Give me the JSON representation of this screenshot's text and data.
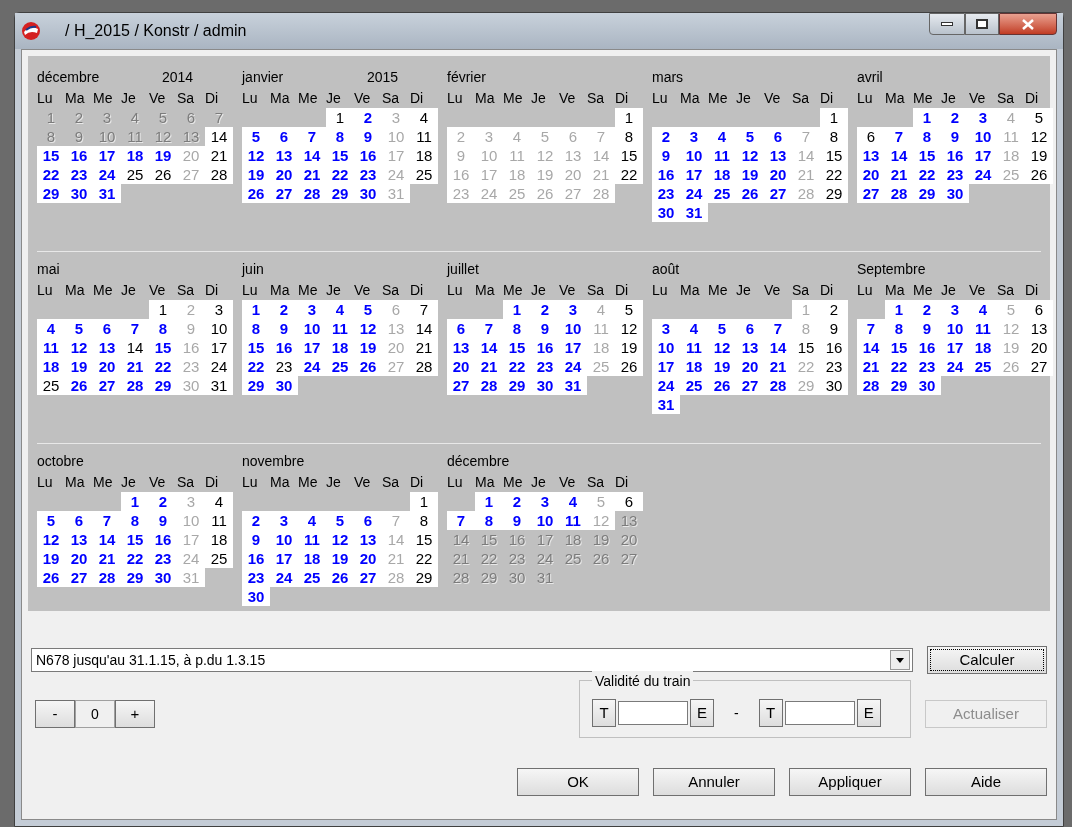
{
  "window": {
    "title": "/ H_2015 / Konstr / admin"
  },
  "months": [
    {
      "name": "décembre",
      "year": "2014",
      "kind": "monday",
      "weekdays": [
        "Lu",
        "Ma",
        "Me",
        "Je",
        "Ve",
        "Sa",
        "Di"
      ],
      "days": [
        {
          "text": "1",
          "kind": "outside"
        },
        {
          "text": "2",
          "kind": "outside"
        },
        {
          "text": "3",
          "kind": "outside"
        },
        {
          "text": "4",
          "kind": "outside"
        },
        {
          "text": "5",
          "kind": "outside"
        },
        {
          "text": "6",
          "kind": "outside"
        },
        {
          "text": "7",
          "kind": "outside"
        },
        {
          "text": "8",
          "kind": "outside"
        },
        {
          "text": "9",
          "kind": "outside"
        },
        {
          "text": "10",
          "kind": "outside"
        },
        {
          "text": "11",
          "kind": "outside"
        },
        {
          "text": "12",
          "kind": "outside"
        },
        {
          "text": "13",
          "kind": "outside"
        },
        {
          "text": "14",
          "kind": "plain"
        },
        {
          "text": "15",
          "kind": "active"
        },
        {
          "text": "16",
          "kind": "active"
        },
        {
          "text": "17",
          "kind": "active"
        },
        {
          "text": "18",
          "kind": "active"
        },
        {
          "text": "19",
          "kind": "active"
        },
        {
          "text": "20",
          "kind": "grey"
        },
        {
          "text": "21",
          "kind": "plain"
        },
        {
          "text": "22",
          "kind": "active"
        },
        {
          "text": "23",
          "kind": "active"
        },
        {
          "text": "24",
          "kind": "active"
        },
        {
          "text": "25",
          "kind": "plain"
        },
        {
          "text": "26",
          "kind": "plain"
        },
        {
          "text": "27",
          "kind": "grey"
        },
        {
          "text": "28",
          "kind": "plain"
        },
        {
          "text": "29",
          "kind": "active"
        },
        {
          "text": "30",
          "kind": "active"
        },
        {
          "text": "31",
          "kind": "active"
        }
      ]
    },
    {
      "name": "janvier",
      "year": "2015",
      "kind": "thursday",
      "weekdays": [
        "Lu",
        "Ma",
        "Me",
        "Je",
        "Ve",
        "Sa",
        "Di"
      ],
      "days": [
        {
          "text": "1",
          "kind": "plain"
        },
        {
          "text": "2",
          "kind": "active"
        },
        {
          "text": "3",
          "kind": "grey"
        },
        {
          "text": "4",
          "kind": "plain"
        },
        {
          "text": "5",
          "kind": "active"
        },
        {
          "text": "6",
          "kind": "active"
        },
        {
          "text": "7",
          "kind": "active"
        },
        {
          "text": "8",
          "kind": "active"
        },
        {
          "text": "9",
          "kind": "active"
        },
        {
          "text": "10",
          "kind": "grey"
        },
        {
          "text": "11",
          "kind": "plain"
        },
        {
          "text": "12",
          "kind": "active"
        },
        {
          "text": "13",
          "kind": "active"
        },
        {
          "text": "14",
          "kind": "active"
        },
        {
          "text": "15",
          "kind": "active"
        },
        {
          "text": "16",
          "kind": "active"
        },
        {
          "text": "17",
          "kind": "grey"
        },
        {
          "text": "18",
          "kind": "plain"
        },
        {
          "text": "19",
          "kind": "active"
        },
        {
          "text": "20",
          "kind": "active"
        },
        {
          "text": "21",
          "kind": "active"
        },
        {
          "text": "22",
          "kind": "active"
        },
        {
          "text": "23",
          "kind": "active"
        },
        {
          "text": "24",
          "kind": "grey"
        },
        {
          "text": "25",
          "kind": "plain"
        },
        {
          "text": "26",
          "kind": "active"
        },
        {
          "text": "27",
          "kind": "active"
        },
        {
          "text": "28",
          "kind": "active"
        },
        {
          "text": "29",
          "kind": "active"
        },
        {
          "text": "30",
          "kind": "active"
        },
        {
          "text": "31",
          "kind": "grey"
        }
      ]
    },
    {
      "name": "février",
      "kind": "sunday",
      "weekdays": [
        "Lu",
        "Ma",
        "Me",
        "Je",
        "Ve",
        "Sa",
        "Di"
      ],
      "days": [
        {
          "text": "1",
          "kind": "plain"
        },
        {
          "text": "2",
          "kind": "grey"
        },
        {
          "text": "3",
          "kind": "grey"
        },
        {
          "text": "4",
          "kind": "grey"
        },
        {
          "text": "5",
          "kind": "grey"
        },
        {
          "text": "6",
          "kind": "grey"
        },
        {
          "text": "7",
          "kind": "grey"
        },
        {
          "text": "8",
          "kind": "plain"
        },
        {
          "text": "9",
          "kind": "grey"
        },
        {
          "text": "10",
          "kind": "grey"
        },
        {
          "text": "11",
          "kind": "grey"
        },
        {
          "text": "12",
          "kind": "grey"
        },
        {
          "text": "13",
          "kind": "grey"
        },
        {
          "text": "14",
          "kind": "grey"
        },
        {
          "text": "15",
          "kind": "plain"
        },
        {
          "text": "16",
          "kind": "grey"
        },
        {
          "text": "17",
          "kind": "grey"
        },
        {
          "text": "18",
          "kind": "grey"
        },
        {
          "text": "19",
          "kind": "grey"
        },
        {
          "text": "20",
          "kind": "grey"
        },
        {
          "text": "21",
          "kind": "grey"
        },
        {
          "text": "22",
          "kind": "plain"
        },
        {
          "text": "23",
          "kind": "grey"
        },
        {
          "text": "24",
          "kind": "grey"
        },
        {
          "text": "25",
          "kind": "grey"
        },
        {
          "text": "26",
          "kind": "grey"
        },
        {
          "text": "27",
          "kind": "grey"
        },
        {
          "text": "28",
          "kind": "grey"
        }
      ]
    },
    {
      "name": "mars",
      "kind": "sunday",
      "weekdays": [
        "Lu",
        "Ma",
        "Me",
        "Je",
        "Ve",
        "Sa",
        "Di"
      ],
      "days": [
        {
          "text": "1",
          "kind": "plain"
        },
        {
          "text": "2",
          "kind": "active"
        },
        {
          "text": "3",
          "kind": "active"
        },
        {
          "text": "4",
          "kind": "active"
        },
        {
          "text": "5",
          "kind": "active"
        },
        {
          "text": "6",
          "kind": "active"
        },
        {
          "text": "7",
          "kind": "grey"
        },
        {
          "text": "8",
          "kind": "plain"
        },
        {
          "text": "9",
          "kind": "active"
        },
        {
          "text": "10",
          "kind": "active"
        },
        {
          "text": "11",
          "kind": "active"
        },
        {
          "text": "12",
          "kind": "active"
        },
        {
          "text": "13",
          "kind": "active"
        },
        {
          "text": "14",
          "kind": "grey"
        },
        {
          "text": "15",
          "kind": "plain"
        },
        {
          "text": "16",
          "kind": "active"
        },
        {
          "text": "17",
          "kind": "active"
        },
        {
          "text": "18",
          "kind": "active"
        },
        {
          "text": "19",
          "kind": "active"
        },
        {
          "text": "20",
          "kind": "active"
        },
        {
          "text": "21",
          "kind": "grey"
        },
        {
          "text": "22",
          "kind": "plain"
        },
        {
          "text": "23",
          "kind": "active"
        },
        {
          "text": "24",
          "kind": "active"
        },
        {
          "text": "25",
          "kind": "active"
        },
        {
          "text": "26",
          "kind": "active"
        },
        {
          "text": "27",
          "kind": "active"
        },
        {
          "text": "28",
          "kind": "grey"
        },
        {
          "text": "29",
          "kind": "plain"
        },
        {
          "text": "30",
          "kind": "active"
        },
        {
          "text": "31",
          "kind": "active"
        }
      ]
    },
    {
      "name": "avril",
      "kind": "wednesday",
      "weekdays": [
        "Lu",
        "Ma",
        "Me",
        "Je",
        "Ve",
        "Sa",
        "Di"
      ],
      "days": [
        {
          "text": "1",
          "kind": "active"
        },
        {
          "text": "2",
          "kind": "active"
        },
        {
          "text": "3",
          "kind": "active"
        },
        {
          "text": "4",
          "kind": "grey"
        },
        {
          "text": "5",
          "kind": "plain"
        },
        {
          "text": "6",
          "kind": "plain"
        },
        {
          "text": "7",
          "kind": "active"
        },
        {
          "text": "8",
          "kind": "active"
        },
        {
          "text": "9",
          "kind": "active"
        },
        {
          "text": "10",
          "kind": "active"
        },
        {
          "text": "11",
          "kind": "grey"
        },
        {
          "text": "12",
          "kind": "plain"
        },
        {
          "text": "13",
          "kind": "active"
        },
        {
          "text": "14",
          "kind": "active"
        },
        {
          "text": "15",
          "kind": "active"
        },
        {
          "text": "16",
          "kind": "active"
        },
        {
          "text": "17",
          "kind": "active"
        },
        {
          "text": "18",
          "kind": "grey"
        },
        {
          "text": "19",
          "kind": "plain"
        },
        {
          "text": "20",
          "kind": "active"
        },
        {
          "text": "21",
          "kind": "active"
        },
        {
          "text": "22",
          "kind": "active"
        },
        {
          "text": "23",
          "kind": "active"
        },
        {
          "text": "24",
          "kind": "active"
        },
        {
          "text": "25",
          "kind": "grey"
        },
        {
          "text": "26",
          "kind": "plain"
        },
        {
          "text": "27",
          "kind": "active"
        },
        {
          "text": "28",
          "kind": "active"
        },
        {
          "text": "29",
          "kind": "active"
        },
        {
          "text": "30",
          "kind": "active"
        }
      ]
    },
    {
      "name": "mai",
      "kind": "friday",
      "weekdays": [
        "Lu",
        "Ma",
        "Me",
        "Je",
        "Ve",
        "Sa",
        "Di"
      ],
      "days": [
        {
          "text": "1",
          "kind": "plain"
        },
        {
          "text": "2",
          "kind": "grey"
        },
        {
          "text": "3",
          "kind": "plain"
        },
        {
          "text": "4",
          "kind": "active"
        },
        {
          "text": "5",
          "kind": "active"
        },
        {
          "text": "6",
          "kind": "active"
        },
        {
          "text": "7",
          "kind": "active"
        },
        {
          "text": "8",
          "kind": "active"
        },
        {
          "text": "9",
          "kind": "grey"
        },
        {
          "text": "10",
          "kind": "plain"
        },
        {
          "text": "11",
          "kind": "active"
        },
        {
          "text": "12",
          "kind": "active"
        },
        {
          "text": "13",
          "kind": "active"
        },
        {
          "text": "14",
          "kind": "plain"
        },
        {
          "text": "15",
          "kind": "active"
        },
        {
          "text": "16",
          "kind": "grey"
        },
        {
          "text": "17",
          "kind": "plain"
        },
        {
          "text": "18",
          "kind": "active"
        },
        {
          "text": "19",
          "kind": "active"
        },
        {
          "text": "20",
          "kind": "active"
        },
        {
          "text": "21",
          "kind": "active"
        },
        {
          "text": "22",
          "kind": "active"
        },
        {
          "text": "23",
          "kind": "grey"
        },
        {
          "text": "24",
          "kind": "plain"
        },
        {
          "text": "25",
          "kind": "plain"
        },
        {
          "text": "26",
          "kind": "active"
        },
        {
          "text": "27",
          "kind": "active"
        },
        {
          "text": "28",
          "kind": "active"
        },
        {
          "text": "29",
          "kind": "active"
        },
        {
          "text": "30",
          "kind": "grey"
        },
        {
          "text": "31",
          "kind": "plain"
        }
      ]
    },
    {
      "name": "juin",
      "kind": "monday",
      "weekdays": [
        "Lu",
        "Ma",
        "Me",
        "Je",
        "Ve",
        "Sa",
        "Di"
      ],
      "days": [
        {
          "text": "1",
          "kind": "active"
        },
        {
          "text": "2",
          "kind": "active"
        },
        {
          "text": "3",
          "kind": "active"
        },
        {
          "text": "4",
          "kind": "active"
        },
        {
          "text": "5",
          "kind": "active"
        },
        {
          "text": "6",
          "kind": "grey"
        },
        {
          "text": "7",
          "kind": "plain"
        },
        {
          "text": "8",
          "kind": "active"
        },
        {
          "text": "9",
          "kind": "active"
        },
        {
          "text": "10",
          "kind": "active"
        },
        {
          "text": "11",
          "kind": "active"
        },
        {
          "text": "12",
          "kind": "active"
        },
        {
          "text": "13",
          "kind": "grey"
        },
        {
          "text": "14",
          "kind": "plain"
        },
        {
          "text": "15",
          "kind": "active"
        },
        {
          "text": "16",
          "kind": "active"
        },
        {
          "text": "17",
          "kind": "active"
        },
        {
          "text": "18",
          "kind": "active"
        },
        {
          "text": "19",
          "kind": "active"
        },
        {
          "text": "20",
          "kind": "grey"
        },
        {
          "text": "21",
          "kind": "plain"
        },
        {
          "text": "22",
          "kind": "active"
        },
        {
          "text": "23",
          "kind": "plain"
        },
        {
          "text": "24",
          "kind": "active"
        },
        {
          "text": "25",
          "kind": "active"
        },
        {
          "text": "26",
          "kind": "active"
        },
        {
          "text": "27",
          "kind": "grey"
        },
        {
          "text": "28",
          "kind": "plain"
        },
        {
          "text": "29",
          "kind": "active"
        },
        {
          "text": "30",
          "kind": "active"
        }
      ]
    },
    {
      "name": "juillet",
      "kind": "wednesday",
      "weekdays": [
        "Lu",
        "Ma",
        "Me",
        "Je",
        "Ve",
        "Sa",
        "Di"
      ],
      "days": [
        {
          "text": "1",
          "kind": "active"
        },
        {
          "text": "2",
          "kind": "active"
        },
        {
          "text": "3",
          "kind": "active"
        },
        {
          "text": "4",
          "kind": "grey"
        },
        {
          "text": "5",
          "kind": "plain"
        },
        {
          "text": "6",
          "kind": "active"
        },
        {
          "text": "7",
          "kind": "active"
        },
        {
          "text": "8",
          "kind": "active"
        },
        {
          "text": "9",
          "kind": "active"
        },
        {
          "text": "10",
          "kind": "active"
        },
        {
          "text": "11",
          "kind": "grey"
        },
        {
          "text": "12",
          "kind": "plain"
        },
        {
          "text": "13",
          "kind": "active"
        },
        {
          "text": "14",
          "kind": "active"
        },
        {
          "text": "15",
          "kind": "active"
        },
        {
          "text": "16",
          "kind": "active"
        },
        {
          "text": "17",
          "kind": "active"
        },
        {
          "text": "18",
          "kind": "grey"
        },
        {
          "text": "19",
          "kind": "plain"
        },
        {
          "text": "20",
          "kind": "active"
        },
        {
          "text": "21",
          "kind": "active"
        },
        {
          "text": "22",
          "kind": "active"
        },
        {
          "text": "23",
          "kind": "active"
        },
        {
          "text": "24",
          "kind": "active"
        },
        {
          "text": "25",
          "kind": "grey"
        },
        {
          "text": "26",
          "kind": "plain"
        },
        {
          "text": "27",
          "kind": "active"
        },
        {
          "text": "28",
          "kind": "active"
        },
        {
          "text": "29",
          "kind": "active"
        },
        {
          "text": "30",
          "kind": "active"
        },
        {
          "text": "31",
          "kind": "active"
        }
      ]
    },
    {
      "name": "août",
      "kind": "saturday",
      "weekdays": [
        "Lu",
        "Ma",
        "Me",
        "Je",
        "Ve",
        "Sa",
        "Di"
      ],
      "days": [
        {
          "text": "1",
          "kind": "grey"
        },
        {
          "text": "2",
          "kind": "plain"
        },
        {
          "text": "3",
          "kind": "active"
        },
        {
          "text": "4",
          "kind": "active"
        },
        {
          "text": "5",
          "kind": "active"
        },
        {
          "text": "6",
          "kind": "active"
        },
        {
          "text": "7",
          "kind": "active"
        },
        {
          "text": "8",
          "kind": "grey"
        },
        {
          "text": "9",
          "kind": "plain"
        },
        {
          "text": "10",
          "kind": "active"
        },
        {
          "text": "11",
          "kind": "active"
        },
        {
          "text": "12",
          "kind": "active"
        },
        {
          "text": "13",
          "kind": "active"
        },
        {
          "text": "14",
          "kind": "active"
        },
        {
          "text": "15",
          "kind": "plain"
        },
        {
          "text": "16",
          "kind": "plain"
        },
        {
          "text": "17",
          "kind": "active"
        },
        {
          "text": "18",
          "kind": "active"
        },
        {
          "text": "19",
          "kind": "active"
        },
        {
          "text": "20",
          "kind": "active"
        },
        {
          "text": "21",
          "kind": "active"
        },
        {
          "text": "22",
          "kind": "grey"
        },
        {
          "text": "23",
          "kind": "plain"
        },
        {
          "text": "24",
          "kind": "active"
        },
        {
          "text": "25",
          "kind": "active"
        },
        {
          "text": "26",
          "kind": "active"
        },
        {
          "text": "27",
          "kind": "active"
        },
        {
          "text": "28",
          "kind": "active"
        },
        {
          "text": "29",
          "kind": "grey"
        },
        {
          "text": "30",
          "kind": "plain"
        },
        {
          "text": "31",
          "kind": "active"
        }
      ]
    },
    {
      "name": "Septembre",
      "kind": "tuesday",
      "weekdays": [
        "Lu",
        "Ma",
        "Me",
        "Je",
        "Ve",
        "Sa",
        "Di"
      ],
      "days": [
        {
          "text": "1",
          "kind": "active"
        },
        {
          "text": "2",
          "kind": "active"
        },
        {
          "text": "3",
          "kind": "active"
        },
        {
          "text": "4",
          "kind": "active"
        },
        {
          "text": "5",
          "kind": "grey"
        },
        {
          "text": "6",
          "kind": "plain"
        },
        {
          "text": "7",
          "kind": "active"
        },
        {
          "text": "8",
          "kind": "active"
        },
        {
          "text": "9",
          "kind": "active"
        },
        {
          "text": "10",
          "kind": "active"
        },
        {
          "text": "11",
          "kind": "active"
        },
        {
          "text": "12",
          "kind": "grey"
        },
        {
          "text": "13",
          "kind": "plain"
        },
        {
          "text": "14",
          "kind": "active"
        },
        {
          "text": "15",
          "kind": "active"
        },
        {
          "text": "16",
          "kind": "active"
        },
        {
          "text": "17",
          "kind": "active"
        },
        {
          "text": "18",
          "kind": "active"
        },
        {
          "text": "19",
          "kind": "grey"
        },
        {
          "text": "20",
          "kind": "plain"
        },
        {
          "text": "21",
          "kind": "active"
        },
        {
          "text": "22",
          "kind": "active"
        },
        {
          "text": "23",
          "kind": "active"
        },
        {
          "text": "24",
          "kind": "active"
        },
        {
          "text": "25",
          "kind": "active"
        },
        {
          "text": "26",
          "kind": "grey"
        },
        {
          "text": "27",
          "kind": "plain"
        },
        {
          "text": "28",
          "kind": "active"
        },
        {
          "text": "29",
          "kind": "active"
        },
        {
          "text": "30",
          "kind": "active"
        }
      ]
    },
    {
      "name": "octobre",
      "kind": "thursday",
      "weekdays": [
        "Lu",
        "Ma",
        "Me",
        "Je",
        "Ve",
        "Sa",
        "Di"
      ],
      "days": [
        {
          "text": "1",
          "kind": "active"
        },
        {
          "text": "2",
          "kind": "active"
        },
        {
          "text": "3",
          "kind": "grey"
        },
        {
          "text": "4",
          "kind": "plain"
        },
        {
          "text": "5",
          "kind": "active"
        },
        {
          "text": "6",
          "kind": "active"
        },
        {
          "text": "7",
          "kind": "active"
        },
        {
          "text": "8",
          "kind": "active"
        },
        {
          "text": "9",
          "kind": "active"
        },
        {
          "text": "10",
          "kind": "grey"
        },
        {
          "text": "11",
          "kind": "plain"
        },
        {
          "text": "12",
          "kind": "active"
        },
        {
          "text": "13",
          "kind": "active"
        },
        {
          "text": "14",
          "kind": "active"
        },
        {
          "text": "15",
          "kind": "active"
        },
        {
          "text": "16",
          "kind": "active"
        },
        {
          "text": "17",
          "kind": "grey"
        },
        {
          "text": "18",
          "kind": "plain"
        },
        {
          "text": "19",
          "kind": "active"
        },
        {
          "text": "20",
          "kind": "active"
        },
        {
          "text": "21",
          "kind": "active"
        },
        {
          "text": "22",
          "kind": "active"
        },
        {
          "text": "23",
          "kind": "active"
        },
        {
          "text": "24",
          "kind": "grey"
        },
        {
          "text": "25",
          "kind": "plain"
        },
        {
          "text": "26",
          "kind": "active"
        },
        {
          "text": "27",
          "kind": "active"
        },
        {
          "text": "28",
          "kind": "active"
        },
        {
          "text": "29",
          "kind": "active"
        },
        {
          "text": "30",
          "kind": "active"
        },
        {
          "text": "31",
          "kind": "grey"
        }
      ]
    },
    {
      "name": "novembre",
      "kind": "sunday",
      "weekdays": [
        "Lu",
        "Ma",
        "Me",
        "Je",
        "Ve",
        "Sa",
        "Di"
      ],
      "days": [
        {
          "text": "1",
          "kind": "plain"
        },
        {
          "text": "2",
          "kind": "active"
        },
        {
          "text": "3",
          "kind": "active"
        },
        {
          "text": "4",
          "kind": "active"
        },
        {
          "text": "5",
          "kind": "active"
        },
        {
          "text": "6",
          "kind": "active"
        },
        {
          "text": "7",
          "kind": "grey"
        },
        {
          "text": "8",
          "kind": "plain"
        },
        {
          "text": "9",
          "kind": "active"
        },
        {
          "text": "10",
          "kind": "active"
        },
        {
          "text": "11",
          "kind": "active"
        },
        {
          "text": "12",
          "kind": "active"
        },
        {
          "text": "13",
          "kind": "active"
        },
        {
          "text": "14",
          "kind": "grey"
        },
        {
          "text": "15",
          "kind": "plain"
        },
        {
          "text": "16",
          "kind": "active"
        },
        {
          "text": "17",
          "kind": "active"
        },
        {
          "text": "18",
          "kind": "active"
        },
        {
          "text": "19",
          "kind": "active"
        },
        {
          "text": "20",
          "kind": "active"
        },
        {
          "text": "21",
          "kind": "grey"
        },
        {
          "text": "22",
          "kind": "plain"
        },
        {
          "text": "23",
          "kind": "active"
        },
        {
          "text": "24",
          "kind": "active"
        },
        {
          "text": "25",
          "kind": "active"
        },
        {
          "text": "26",
          "kind": "active"
        },
        {
          "text": "27",
          "kind": "active"
        },
        {
          "text": "28",
          "kind": "grey"
        },
        {
          "text": "29",
          "kind": "plain"
        },
        {
          "text": "30",
          "kind": "active"
        }
      ]
    },
    {
      "name": "décembre",
      "kind": "tuesday",
      "weekdays": [
        "Lu",
        "Ma",
        "Me",
        "Je",
        "Ve",
        "Sa",
        "Di"
      ],
      "days": [
        {
          "text": "1",
          "kind": "active"
        },
        {
          "text": "2",
          "kind": "active"
        },
        {
          "text": "3",
          "kind": "active"
        },
        {
          "text": "4",
          "kind": "active"
        },
        {
          "text": "5",
          "kind": "grey"
        },
        {
          "text": "6",
          "kind": "plain"
        },
        {
          "text": "7",
          "kind": "active"
        },
        {
          "text": "8",
          "kind": "active"
        },
        {
          "text": "9",
          "kind": "active"
        },
        {
          "text": "10",
          "kind": "active"
        },
        {
          "text": "11",
          "kind": "active"
        },
        {
          "text": "12",
          "kind": "grey"
        },
        {
          "text": "13",
          "kind": "outside"
        },
        {
          "text": "14",
          "kind": "outside"
        },
        {
          "text": "15",
          "kind": "outside"
        },
        {
          "text": "16",
          "kind": "outside"
        },
        {
          "text": "17",
          "kind": "outside"
        },
        {
          "text": "18",
          "kind": "outside"
        },
        {
          "text": "19",
          "kind": "outside"
        },
        {
          "text": "20",
          "kind": "outside"
        },
        {
          "text": "21",
          "kind": "outside"
        },
        {
          "text": "22",
          "kind": "outside"
        },
        {
          "text": "23",
          "kind": "outside"
        },
        {
          "text": "24",
          "kind": "outside"
        },
        {
          "text": "25",
          "kind": "outside"
        },
        {
          "text": "26",
          "kind": "outside"
        },
        {
          "text": "27",
          "kind": "outside"
        },
        {
          "text": "28",
          "kind": "outside"
        },
        {
          "text": "29",
          "kind": "outside"
        },
        {
          "text": "30",
          "kind": "outside"
        },
        {
          "text": "31",
          "kind": "outside"
        }
      ]
    }
  ],
  "train_select": {
    "value": "N678 jusqu'au 31.1.15, à p.du 1.3.15"
  },
  "calculate_button": {
    "label": "Calculer"
  },
  "stepper": {
    "minus": "-",
    "value": "0",
    "plus": "+"
  },
  "validity": {
    "title": "Validité du train",
    "from_t": "T",
    "from_e": "E",
    "separator": "-",
    "to_t": "T",
    "to_e": "E"
  },
  "refresh_button": {
    "label": "Actualiser",
    "disabled": true
  },
  "buttons": [
    "OK",
    "Annuler",
    "Appliquer",
    "Aide"
  ]
}
